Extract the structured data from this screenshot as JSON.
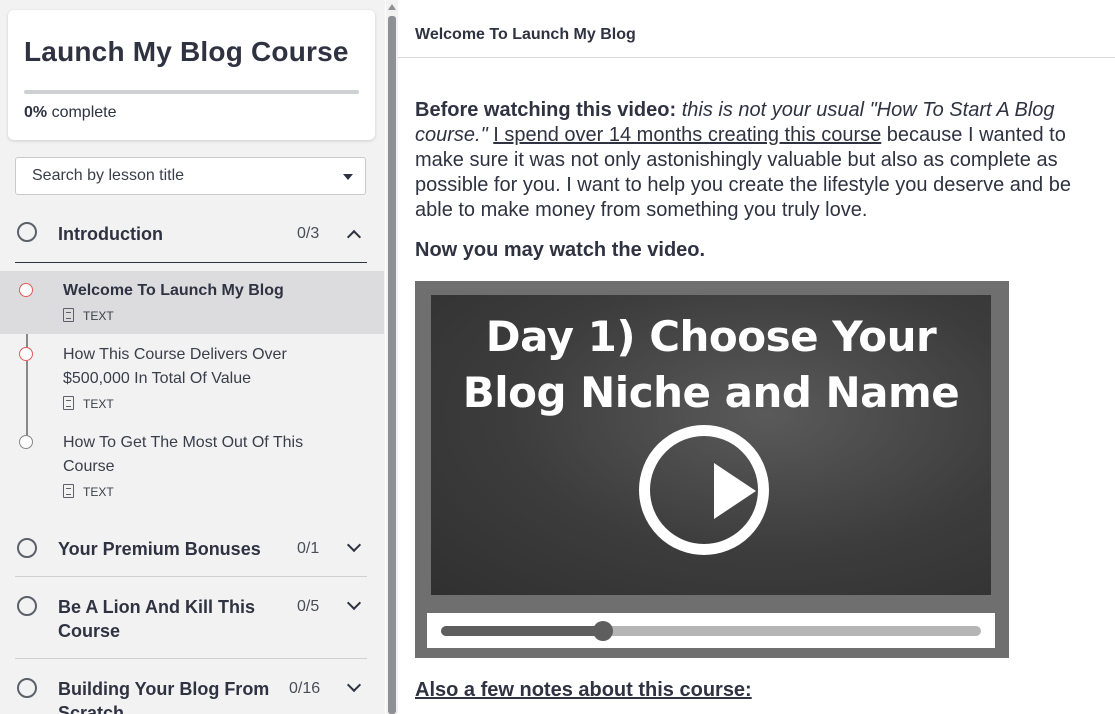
{
  "sidebar": {
    "course_title": "Launch My Blog Course",
    "progress_percent": 0,
    "progress_value": "0%",
    "progress_suffix": "complete",
    "search_placeholder": "Search by lesson title",
    "sections": [
      {
        "title": "Introduction",
        "count": "0/3",
        "expanded": true,
        "lessons": [
          {
            "title": "Welcome To Launch My Blog",
            "type": "TEXT",
            "active": true
          },
          {
            "title": "How This Course Delivers Over $500,000 In Total Of Value",
            "type": "TEXT",
            "active": false
          },
          {
            "title": "How To Get The Most Out Of This Course",
            "type": "TEXT",
            "active": false
          }
        ]
      },
      {
        "title": "Your Premium Bonuses",
        "count": "0/1",
        "expanded": false
      },
      {
        "title": "Be A Lion And Kill This Course",
        "count": "0/5",
        "expanded": false
      },
      {
        "title": "Building Your Blog From Scratch",
        "count": "0/16",
        "expanded": false
      }
    ]
  },
  "main": {
    "header_title": "Welcome To Launch My Blog",
    "intro": {
      "lead_bold": "Before watching this video:",
      "lead_italic": " this is not your usual \"How To Start A Blog course.\"",
      "underlined": "I spend over 14 months creating this course",
      "rest": " because I wanted to make sure it was not only astonishingly valuable but also as complete as possible for you. I want to help you create the lifestyle you deserve and be able to make money from something you truly love."
    },
    "watch_now": "Now you may watch the video.",
    "video": {
      "title_line1": "Day 1) Choose Your",
      "title_line2": "Blog Niche and Name",
      "playback_fraction": 0.3
    },
    "notes_heading": "Also a few notes about this course: "
  },
  "colors": {
    "accent_red": "#e45c55",
    "text_dark": "#2f3241",
    "sidebar_bg": "#f2f2f3",
    "active_row": "#dcdcde"
  }
}
